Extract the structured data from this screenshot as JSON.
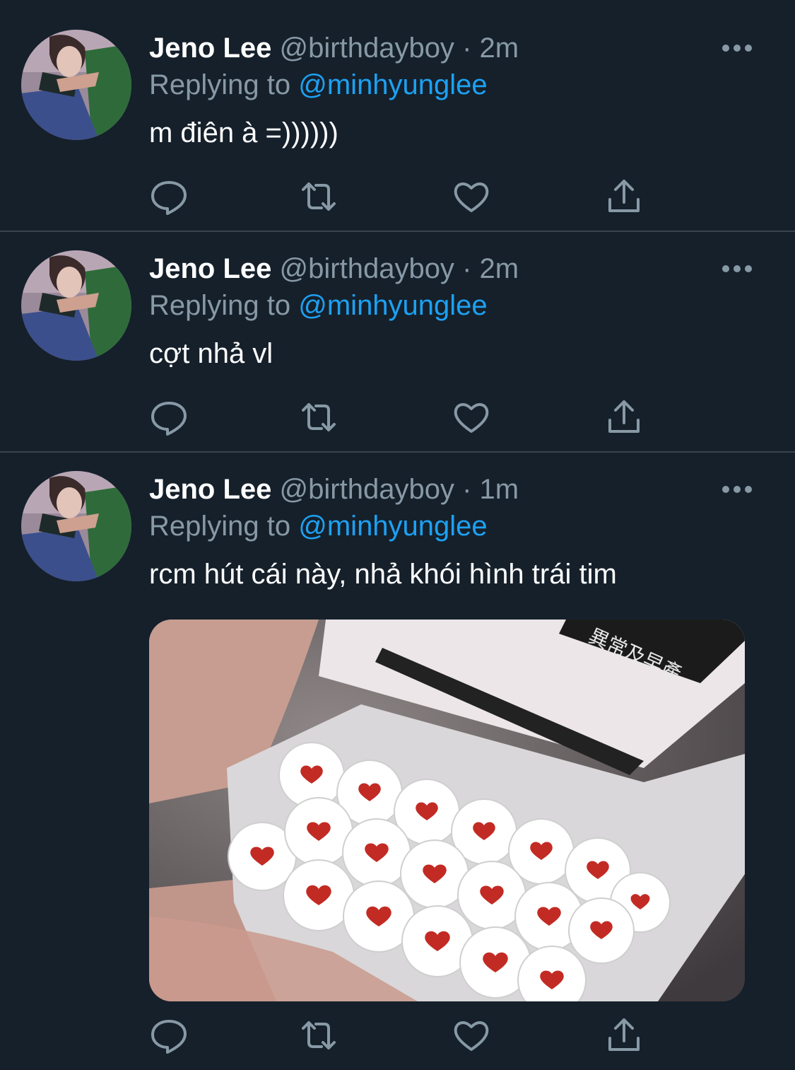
{
  "colors": {
    "background": "#15202b",
    "divider": "#38444d",
    "secondary_text": "#8899a6",
    "link": "#1da1f2",
    "primary_text": "#ffffff"
  },
  "tweets": [
    {
      "display_name": "Jeno Lee",
      "handle": "@birthdayboy",
      "separator": "·",
      "time": "2m",
      "replying_prefix": "Replying to",
      "replying_to": "@minhyunglee",
      "text": "m điên à =))))))",
      "has_media": false
    },
    {
      "display_name": "Jeno Lee",
      "handle": "@birthdayboy",
      "separator": "·",
      "time": "2m",
      "replying_prefix": "Replying to",
      "replying_to": "@minhyunglee",
      "text": "cợt nhả vl",
      "has_media": false
    },
    {
      "display_name": "Jeno Lee",
      "handle": "@birthdayboy",
      "separator": "·",
      "time": "1m",
      "replying_prefix": "Replying to",
      "replying_to": "@minhyunglee",
      "text": "rcm hút cái này, nhả khói hình trái tim",
      "has_media": true,
      "media_caption_chars": "異常及早產"
    }
  ],
  "icons": {
    "more": "more-horizontal-icon",
    "reply": "reply-bubble-icon",
    "retweet": "retweet-icon",
    "like": "heart-outline-icon",
    "share": "share-upload-icon"
  }
}
